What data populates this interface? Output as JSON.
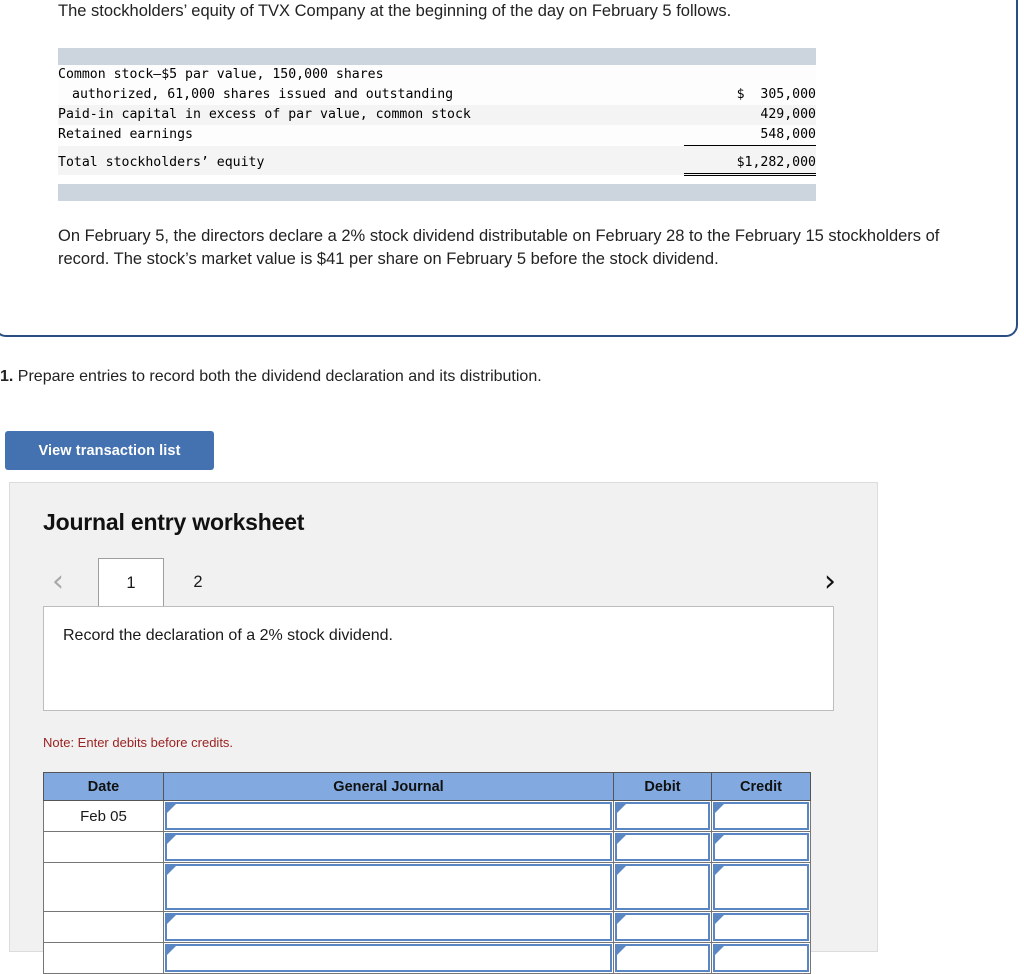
{
  "question": {
    "intro": "The stockholders’ equity of TVX Company at the beginning of the day on February 5 follows.",
    "body": "On February 5, the directors declare a 2% stock dividend distributable on February 28 to the February 15 stockholders of record. The stock’s market value is $41 per share on February 5 before the stock dividend."
  },
  "equity_statement": {
    "rows": [
      {
        "label_line1": "Common stock—$5 par value, 150,000 shares",
        "label_line2": "authorized, 61,000 shares issued and outstanding",
        "amount": "$  305,000"
      },
      {
        "label_line1": "Paid-in capital in excess of par value, common stock",
        "label_line2": "",
        "amount": "429,000"
      },
      {
        "label_line1": "Retained earnings",
        "label_line2": "",
        "amount": "548,000"
      },
      {
        "label_line1": "Total stockholders’ equity",
        "label_line2": "",
        "amount": "$1,282,000"
      }
    ]
  },
  "requirement": {
    "number": "1.",
    "text": " Prepare entries to record both the dividend declaration and its distribution."
  },
  "toolbar": {
    "view_transaction_list_label": "View transaction list"
  },
  "worksheet": {
    "title": "Journal entry worksheet",
    "prev_icon": "chevron-left-icon",
    "next_icon": "chevron-right-icon",
    "tabs": [
      {
        "label": "1",
        "active": true
      },
      {
        "label": "2",
        "active": false
      }
    ],
    "description": "Record the declaration of a 2% stock dividend.",
    "note": "Note: Enter debits before credits.",
    "table": {
      "headers": [
        "Date",
        "General Journal",
        "Debit",
        "Credit"
      ],
      "rows": [
        {
          "date": "Feb 05",
          "general_journal": "",
          "debit": "",
          "credit": ""
        },
        {
          "date": "",
          "general_journal": "",
          "debit": "",
          "credit": ""
        },
        {
          "date": "",
          "general_journal": "",
          "debit": "",
          "credit": ""
        },
        {
          "date": "",
          "general_journal": "",
          "debit": "",
          "credit": ""
        },
        {
          "date": "",
          "general_journal": "",
          "debit": "",
          "credit": ""
        }
      ]
    }
  },
  "colors": {
    "card_border": "#2a4d84",
    "button_blue": "#4472b0",
    "table_header_blue": "#82aae0",
    "field_border_blue": "#5b86c4",
    "note_red": "#9b2222",
    "panel_gray": "#f1f1f1",
    "band_gray": "#ccd4de"
  }
}
